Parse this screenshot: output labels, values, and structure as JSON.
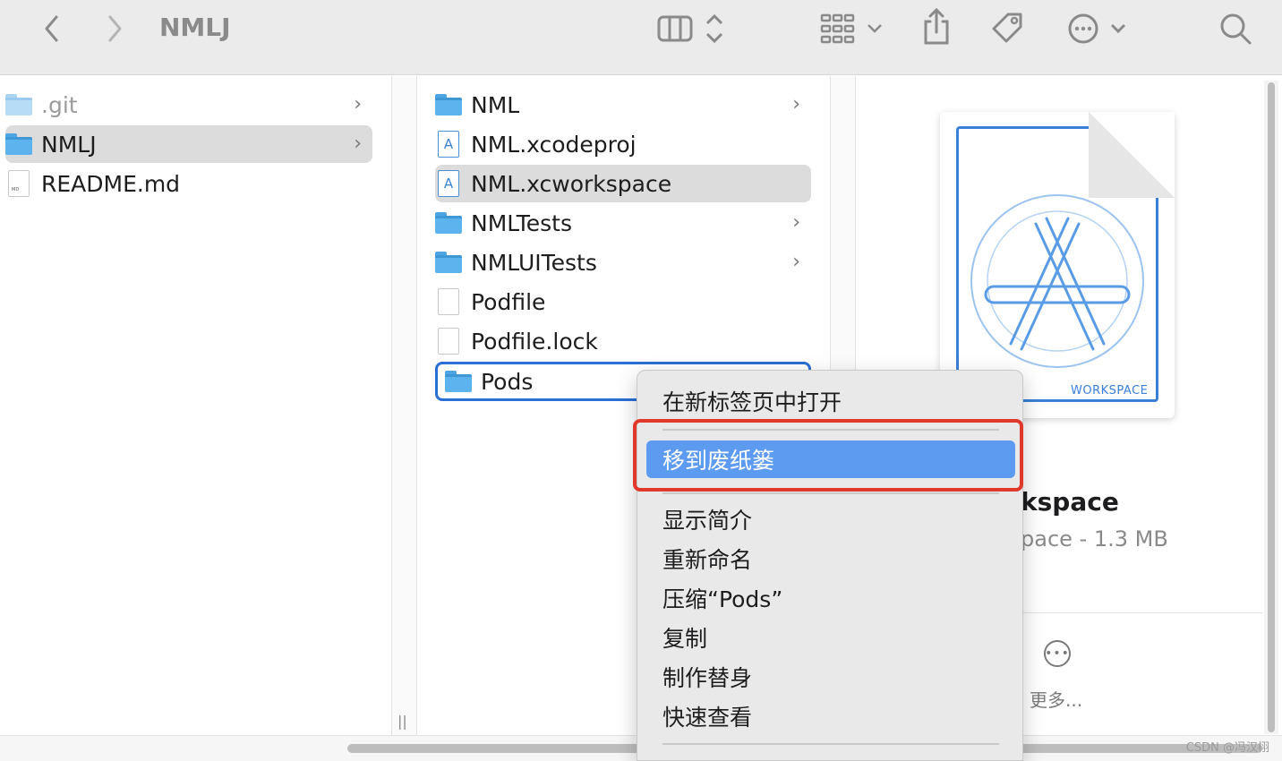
{
  "toolbar": {
    "title": "NMLJ",
    "back_icon": "chevron-left-icon",
    "forward_icon": "chevron-right-icon",
    "view_icon": "column-view-icon",
    "group_icon": "grid-icon",
    "share_icon": "share-icon",
    "tag_icon": "tag-icon",
    "action_icon": "ellipsis-circle-icon",
    "search_icon": "search-icon"
  },
  "column1": {
    "items": [
      {
        "label": ".git",
        "icon": "folder-icon"
      },
      {
        "label": "NMLJ",
        "icon": "folder-icon"
      },
      {
        "label": "README.md",
        "icon": "document-icon"
      }
    ],
    "chev": "›",
    "md_tag": "MD"
  },
  "column2": {
    "items": [
      {
        "label": "NML",
        "icon": "folder-icon"
      },
      {
        "label": "NML.xcodeproj",
        "icon": "xcode-project-icon"
      },
      {
        "label": "NML.xcworkspace",
        "icon": "xcode-workspace-icon"
      },
      {
        "label": "NMLTests",
        "icon": "folder-icon"
      },
      {
        "label": "NMLUITests",
        "icon": "folder-icon"
      },
      {
        "label": "Podfile",
        "icon": "document-icon"
      },
      {
        "label": "Podfile.lock",
        "icon": "document-icon"
      },
      {
        "label": "Pods",
        "icon": "folder-icon"
      }
    ],
    "chev": "›",
    "xc_glyph": "A"
  },
  "preview": {
    "badge": "WORKSPACE",
    "name": "kspace",
    "meta": "pace - 1.3 MB",
    "more_label": "更多...",
    "more_glyph": "•••"
  },
  "context_menu": {
    "items": [
      "在新标签页中打开",
      "移到废纸篓",
      "显示简介",
      "重新命名",
      "压缩“Pods”",
      "复制",
      "制作替身",
      "快速查看"
    ],
    "highlighted_index": 1,
    "highlight_color": "#5d9bf0",
    "annotation_color": "#e0392b"
  },
  "footer": {
    "watermark": "CSDN @冯汉栩",
    "resize_glyph": "||"
  }
}
